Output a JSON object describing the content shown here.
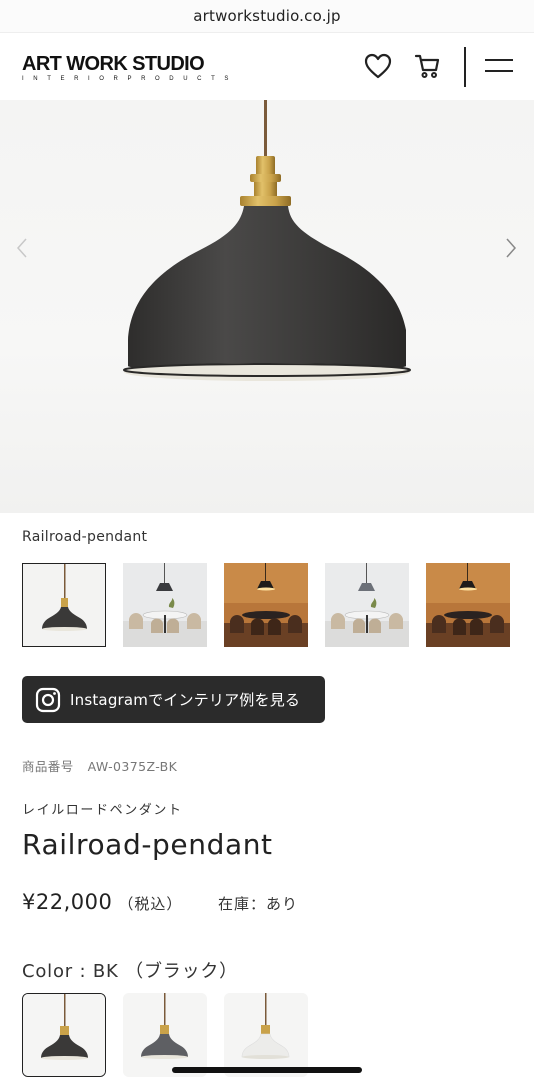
{
  "browser": {
    "url": "artworkstudio.co.jp"
  },
  "header": {
    "logo_main": "ART WORK STUDIO",
    "logo_sub": "INTERIORPRODUCTS",
    "icons": [
      "heart-icon",
      "cart-icon",
      "menu-icon"
    ]
  },
  "hero": {
    "image": "railroad-pendant-black-lamp",
    "prev_icon": "chevron-left-icon",
    "next_icon": "chevron-right-icon"
  },
  "product": {
    "gallery_label": "Railroad-pendant",
    "thumbnails": [
      "pendant-black",
      "dining-room-daylight",
      "dining-room-warm",
      "dining-room-daylight-2",
      "dining-room-warm-2"
    ],
    "instagram_button": "Instagramでインテリア例を見る",
    "sku_label": "商品番号",
    "sku_value": "AW-0375Z-BK",
    "name_jp": "レイルロードペンダント",
    "name": "Railroad-pendant",
    "price": "¥22,000",
    "tax_note": "（税込）",
    "stock": "在庫：あり",
    "color_label": "Color : BK （ブラック）",
    "swatches": [
      "BK",
      "GY",
      "WH"
    ]
  },
  "colors": {
    "accent_dark": "#2b2b2b",
    "brass": "#c9a24a",
    "lamp_black": "#3a3a3a"
  }
}
